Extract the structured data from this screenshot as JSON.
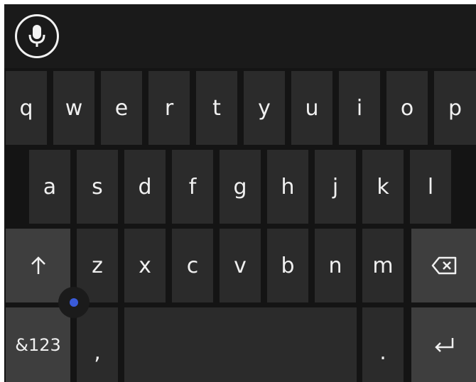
{
  "icons": {
    "mic": "microphone-icon",
    "shift": "shift-up-arrow-icon",
    "backspace": "backspace-icon",
    "enter": "enter-return-icon"
  },
  "colors": {
    "background": "#141414",
    "key": "#2b2b2b",
    "function_key": "#3e3e3e",
    "text": "#f0f0f0",
    "cursor_dot": "#3a5bd9"
  },
  "keyboard": {
    "row1": [
      "q",
      "w",
      "e",
      "r",
      "t",
      "y",
      "u",
      "i",
      "o",
      "p"
    ],
    "row2": [
      "a",
      "s",
      "d",
      "f",
      "g",
      "h",
      "j",
      "k",
      "l"
    ],
    "row3": [
      "z",
      "x",
      "c",
      "v",
      "b",
      "n",
      "m"
    ],
    "symbols_label": "&123",
    "comma_label": ",",
    "period_label": "."
  }
}
